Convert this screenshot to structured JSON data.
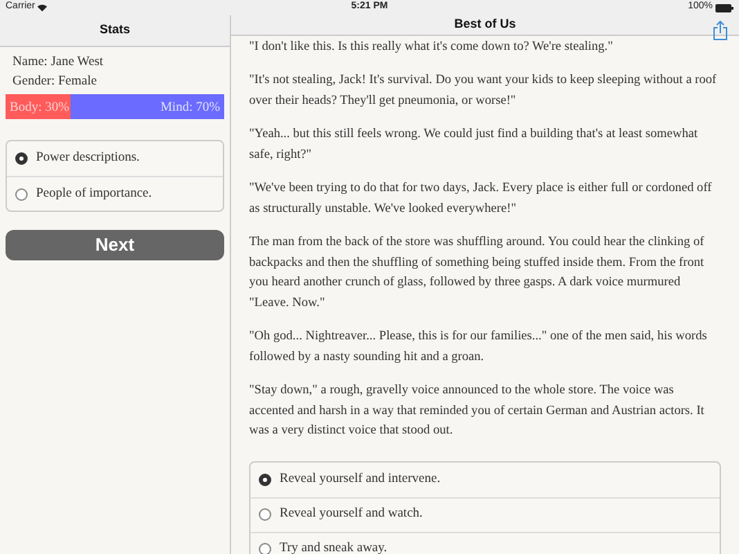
{
  "status_bar": {
    "carrier": "Carrier",
    "time": "5:21 PM",
    "battery": "100%"
  },
  "sidebar": {
    "title": "Stats",
    "name": "Name: Jane West",
    "gender_label": "Gender: Female",
    "meter": {
      "body_label": "Body: 30%",
      "mind_label": "Mind: 70%",
      "level": 0.3
    },
    "options": [
      {
        "label": "Power descriptions.",
        "selected": true
      },
      {
        "label": "People of importance.",
        "selected": false
      }
    ],
    "next_button": "Next"
  },
  "story": {
    "title": "Best of Us",
    "paragraphs": [
      "\"I don't like this. Is this really what it's come down to? We're stealing.\"",
      "\"It's not stealing, Jack! It's survival. Do you want your kids to keep sleeping without a roof over their heads? They'll get pneumonia, or worse!\"",
      "\"Yeah... but this still feels wrong. We could just find a building that's at least somewhat safe, right?\"",
      "\"We've been trying to do that for two days, Jack. Every place is either full or cordoned off as structurally unstable. We've looked everywhere!\"",
      "The man from the back of the store was shuffling around. You could hear the clinking of backpacks and then the shuffling of something being stuffed inside them. From the front you heard another crunch of glass, followed by three gasps. A dark voice murmured \"Leave. Now.\"",
      "\"Oh god... Nightreaver... Please, this is for our families...\" one of the men said, his words followed by a nasty sounding hit and a groan.",
      "\"Stay down,\" a rough, gravelly voice announced to the whole store. The voice was accented and harsh in a way that reminded you of certain German and Austrian actors. It was a very distinct voice that stood out."
    ],
    "choices": [
      {
        "label": "Reveal yourself and intervene.",
        "selected": true
      },
      {
        "label": "Reveal yourself and watch.",
        "selected": false
      },
      {
        "label": "Try and sneak away.",
        "selected": false
      }
    ]
  }
}
